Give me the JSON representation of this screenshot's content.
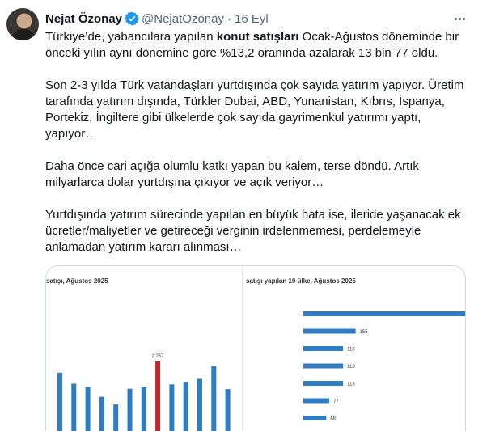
{
  "tweet": {
    "author_name": "Nejat Özonay",
    "handle": "@NejatOzonay",
    "separator": "·",
    "date": "16 Eyl",
    "paragraphs": [
      {
        "pre": "Türkiye’de, yabancılara yapılan ",
        "bold": "konut satışları",
        "post": " Ocak-Ağustos döneminde bir önceki yılın aynı dönemine göre %13,2 oranında azalarak 13 bin 77 oldu."
      },
      {
        "text": "Son 2-3 yılda Türk vatandaşları yurtdışında çok sayıda yatırım yapıyor. Üretim tarafında yatırım dışında, Türkler Dubai, ABD, Yunanistan, Kıbrıs, İspanya, Portekiz, İngiltere gibi ülkelerde çok sayıda gayrimenkul yatırımı yaptı, yapıyor…"
      },
      {
        "text": "Daha önce cari açığa olumlu katkı yapan bu kalem, terse döndü. Artık milyarlarca dolar yurtdışına çıkıyor ve açık veriyor…"
      },
      {
        "text": "Yurtdışında yatırım sürecinde yapılan en büyük hata ise, ileride yaşanacak ek ücretler/maliyetler ve getireceği verginin irdelenmemesi, perdelemeyle anlamadan yatırım kararı alınması…"
      }
    ]
  },
  "icons": {
    "verified": "verified-badge-icon",
    "more": "more-options-icon"
  },
  "colors": {
    "bar_blue": "#2e7cc4",
    "bar_highlight": "#c0282d",
    "verified_blue": "#1d9bf0"
  },
  "chart_data": [
    {
      "type": "bar",
      "title": "satışı, Ağustos 2025",
      "series": [
        {
          "values": [
            1950,
            1650,
            1560,
            1290,
            1080,
            1510,
            1570,
            2257,
            1630,
            1700,
            1780,
            2130,
            1500
          ]
        }
      ],
      "highlight_index": 7,
      "labels": {
        "7": "2 257"
      },
      "ylim": [
        0,
        4200
      ]
    },
    {
      "type": "bar",
      "orientation": "horizontal",
      "title": "satışı yapılan 10 ülke, Ağustos 2025",
      "values": [
        480,
        155,
        118,
        118,
        118,
        77,
        68
      ],
      "value_labels": [
        "",
        "155",
        "118",
        "118",
        "118",
        "77",
        "68"
      ]
    }
  ]
}
